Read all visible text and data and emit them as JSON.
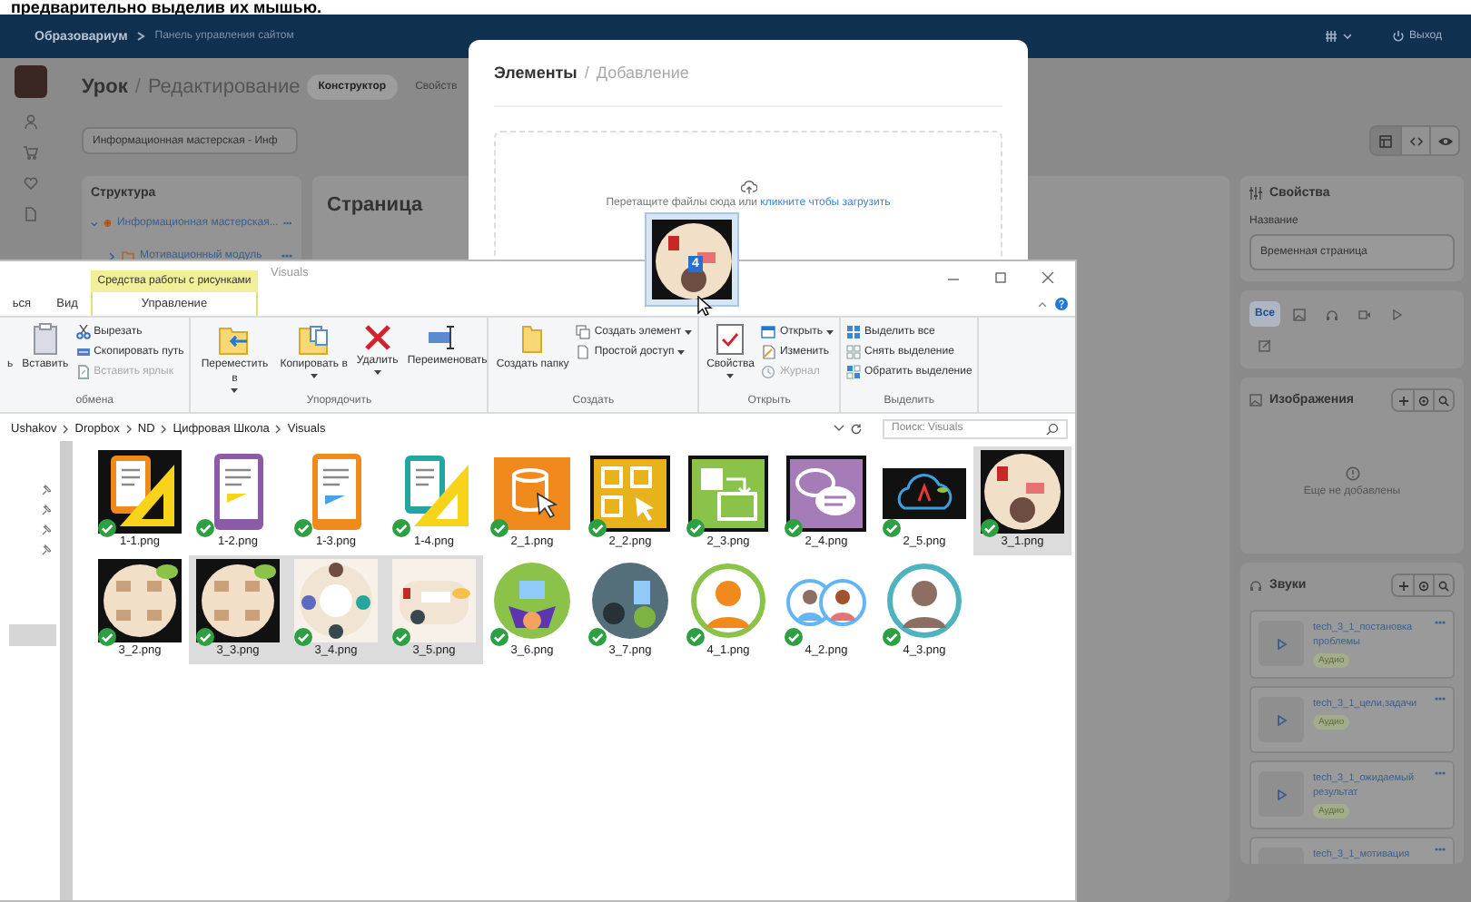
{
  "caption": "предварительно выделив их мышью.",
  "app": {
    "brand": "Образовариум",
    "breadcrumb": "Панель управления сайтом",
    "logout": "Выход",
    "page_title": "Урок",
    "title_separator": "/",
    "page_subtitle": "Редактирование",
    "tabs": [
      {
        "label": "Конструктор",
        "selected": true
      },
      {
        "label": "Свойств",
        "selected": false
      }
    ],
    "course_select": "Информационная мастерская - Инф",
    "view_buttons": [
      {
        "kind": "layout",
        "selected": true
      },
      {
        "kind": "code",
        "selected": false
      },
      {
        "kind": "preview",
        "selected": false
      }
    ],
    "structure": {
      "title": "Структура",
      "tree": [
        {
          "label": "Информационная мастерская...",
          "kind": "course",
          "expanded": true,
          "children": [
            {
              "label": "Мотивационный модуль",
              "kind": "folder",
              "expanded": false
            }
          ]
        }
      ]
    },
    "page_panel": {
      "title": "Страница"
    },
    "properties": {
      "title": "Свойства",
      "name_label": "Название",
      "name_value": "Временная страница"
    },
    "filters": [
      {
        "kind": "all",
        "label": "Все",
        "selected": true
      },
      {
        "kind": "image",
        "selected": false
      },
      {
        "kind": "audio",
        "selected": false
      },
      {
        "kind": "video",
        "selected": false
      },
      {
        "kind": "play",
        "selected": false
      },
      {
        "kind": "edit",
        "selected": false
      }
    ],
    "images": {
      "title": "Изображения",
      "empty": "Еще не добавлены"
    },
    "sounds": {
      "title": "Звуки",
      "items": [
        {
          "title": "tech_3_1_постановка проблемы",
          "tag": "Аудио"
        },
        {
          "title": "tech_3_1_цели,задачи",
          "tag": "Аудио"
        },
        {
          "title": "tech_3_1_ожидаемый результат",
          "tag": "Аудио"
        },
        {
          "title": "tech_3_1_мотивация"
        }
      ]
    }
  },
  "modal": {
    "title": "Элементы",
    "separator": "/",
    "subtitle": "Добавление",
    "hint": "Перетащите файлы сюда или",
    "link": "кликните чтобы загрузить"
  },
  "explorer": {
    "context_tab": "Средства работы с рисунками",
    "title": "Visuals",
    "ribbon_tabs": [
      {
        "label": "ься",
        "selected": false
      },
      {
        "label": "Вид",
        "selected": false
      },
      {
        "label": "Управление",
        "selected": true
      }
    ],
    "ribbon_groups": [
      {
        "label": "обмена",
        "buttons": [
          {
            "kind": "fragment",
            "label": "ь",
            "dropdown": false
          },
          {
            "kind": "paste",
            "label": "Вставить",
            "dropdown": false
          }
        ],
        "stack": [
          {
            "kind": "cut",
            "label": "Вырезать",
            "disabled": false,
            "dropdown": false
          },
          {
            "kind": "copypath",
            "label": "Скопировать путь",
            "disabled": false,
            "dropdown": false
          },
          {
            "kind": "shortcut",
            "label": "Вставить ярлык",
            "disabled": true,
            "dropdown": false
          }
        ]
      },
      {
        "label": "Упорядочить",
        "buttons": [
          {
            "kind": "move",
            "label": "Переместить в",
            "dropdown": true
          },
          {
            "kind": "copy",
            "label": "Копировать в",
            "dropdown": true
          },
          {
            "kind": "delete",
            "label": "Удалить",
            "dropdown": true
          },
          {
            "kind": "rename",
            "label": "Переименовать",
            "dropdown": false
          }
        ]
      },
      {
        "label": "Создать",
        "buttons": [
          {
            "kind": "newfolder",
            "label": "Создать папку",
            "dropdown": false
          }
        ],
        "stack": [
          {
            "kind": "newitem",
            "label": "Создать элемент",
            "dropdown": true,
            "disabled": false
          },
          {
            "kind": "access",
            "label": "Простой доступ",
            "dropdown": true,
            "disabled": false
          }
        ]
      },
      {
        "label": "Открыть",
        "buttons": [
          {
            "kind": "properties",
            "label": "Свойства",
            "dropdown": true
          }
        ],
        "stack": [
          {
            "kind": "open",
            "label": "Открыть",
            "dropdown": true,
            "disabled": false
          },
          {
            "kind": "edit",
            "label": "Изменить",
            "dropdown": false,
            "disabled": false
          },
          {
            "kind": "history",
            "label": "Журнал",
            "dropdown": false,
            "disabled": true
          }
        ]
      },
      {
        "label": "Выделить",
        "stack": [
          {
            "kind": "selectall",
            "label": "Выделить все",
            "disabled": false,
            "dropdown": false
          },
          {
            "kind": "selectnone",
            "label": "Снять выделение",
            "disabled": false,
            "dropdown": false
          },
          {
            "kind": "invert",
            "label": "Обратить выделение",
            "disabled": false,
            "dropdown": false
          }
        ]
      }
    ],
    "path": [
      "Ushakov",
      "Dropbox",
      "ND",
      "Цифровая Школа",
      "Visuals"
    ],
    "search_placeholder": "Поиск: Visuals",
    "files": [
      {
        "name": "1-1.png",
        "kind": "doc-ruler",
        "synced": true,
        "selected": false
      },
      {
        "name": "1-2.png",
        "kind": "doc-purple",
        "synced": true,
        "selected": false
      },
      {
        "name": "1-3.png",
        "kind": "doc-orange",
        "synced": true,
        "selected": false
      },
      {
        "name": "1-4.png",
        "kind": "doc-teal",
        "synced": true,
        "selected": false
      },
      {
        "name": "2_1.png",
        "kind": "db-orange",
        "synced": true,
        "selected": false
      },
      {
        "name": "2_2.png",
        "kind": "grid-yellow",
        "synced": true,
        "selected": false
      },
      {
        "name": "2_3.png",
        "kind": "flow-green",
        "synced": true,
        "selected": false
      },
      {
        "name": "2_4.png",
        "kind": "chat-purple",
        "synced": true,
        "selected": false
      },
      {
        "name": "2_5.png",
        "kind": "cloud-dark",
        "synced": true,
        "selected": false
      },
      {
        "name": "3_1.png",
        "kind": "scene-dark",
        "synced": true,
        "selected": true
      },
      {
        "name": "3_2.png",
        "kind": "scene-table",
        "synced": true,
        "selected": false
      },
      {
        "name": "3_3.png",
        "kind": "scene-table",
        "synced": true,
        "selected": true
      },
      {
        "name": "3_4.png",
        "kind": "scene-round",
        "synced": true,
        "selected": true
      },
      {
        "name": "3_5.png",
        "kind": "scene-light",
        "synced": true,
        "selected": true
      },
      {
        "name": "3_6.png",
        "kind": "tablet-green",
        "synced": true,
        "selected": false
      },
      {
        "name": "3_7.png",
        "kind": "tablet-dark",
        "synced": true,
        "selected": false
      },
      {
        "name": "4_1.png",
        "kind": "person-green",
        "synced": true,
        "selected": false
      },
      {
        "name": "4_2.png",
        "kind": "people-blue",
        "synced": true,
        "selected": false
      },
      {
        "name": "4_3.png",
        "kind": "person-teal",
        "synced": true,
        "selected": false
      }
    ]
  },
  "drag": {
    "count": "4",
    "kind": "scene-dark"
  }
}
